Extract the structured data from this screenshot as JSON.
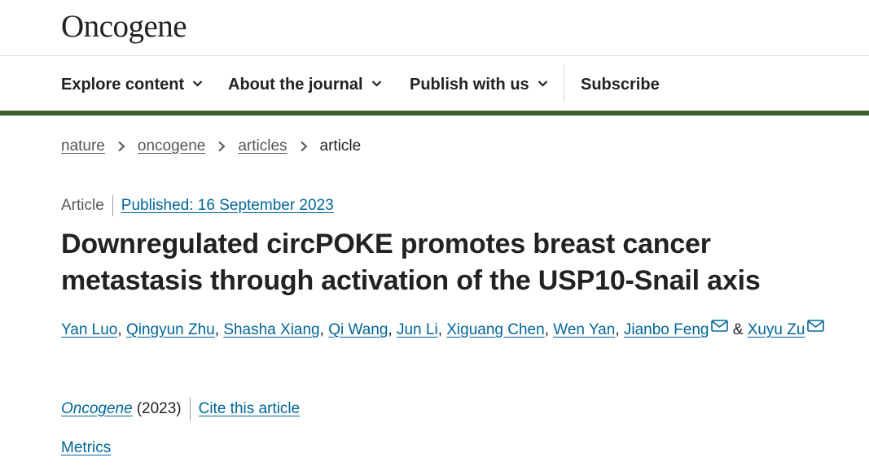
{
  "site": {
    "logo": "Oncogene"
  },
  "nav": {
    "items": [
      {
        "label": "Explore content",
        "has_dropdown": true
      },
      {
        "label": "About the journal",
        "has_dropdown": true
      },
      {
        "label": "Publish with us",
        "has_dropdown": true
      },
      {
        "label": "Subscribe",
        "has_dropdown": false
      }
    ],
    "accent_color": "#3b6130"
  },
  "breadcrumb": {
    "items": [
      "nature",
      "oncogene",
      "articles"
    ],
    "current": "article"
  },
  "article": {
    "type": "Article",
    "published": "Published: 16 September 2023",
    "title": "Downregulated circPOKE promotes breast cancer metastasis through activation of the USP10-Snail axis",
    "authors": [
      "Yan Luo",
      "Qingyun Zhu",
      "Shasha Xiang",
      "Qi Wang",
      "Jun Li",
      "Xiguang Chen",
      "Wen Yan",
      "Jianbo Feng",
      "Xuyu Zu"
    ],
    "corresponding_icon": "mail-icon",
    "journal": "Oncogene",
    "year": "(2023)",
    "cite_label": "Cite this article",
    "metrics_label": "Metrics"
  },
  "colors": {
    "link": "#006699",
    "text": "#222222",
    "muted": "#555555"
  }
}
